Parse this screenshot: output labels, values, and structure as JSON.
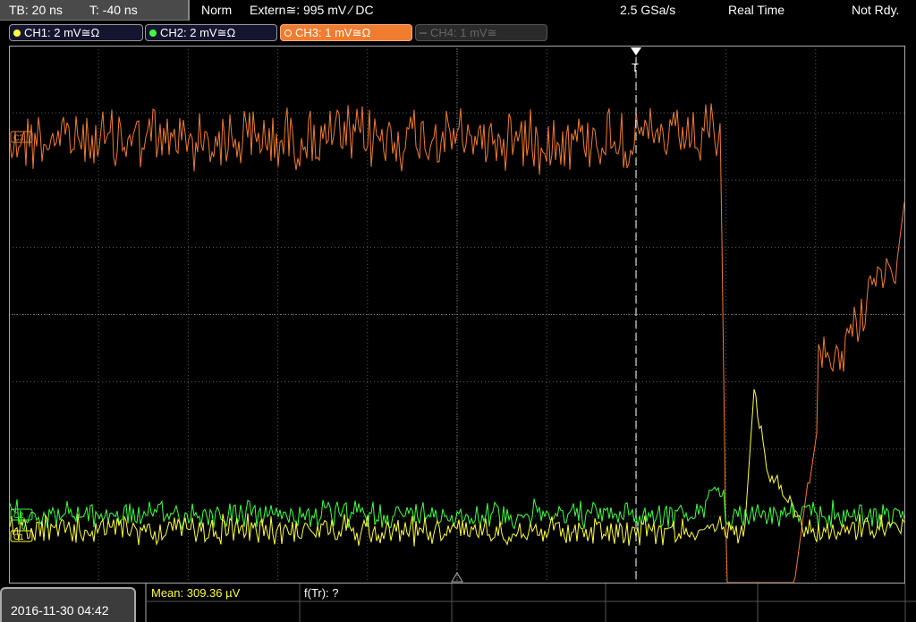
{
  "topbar": {
    "timebase": "TB: 20 ns",
    "trigger_time": "T: -40 ns",
    "trigger_mode": "Norm",
    "trigger_source": "Extern≅: 995 mV ⁄ DC",
    "sample_rate": "2.5 GSa/s",
    "acq_mode": "Real Time",
    "status": "Not Rdy."
  },
  "channels": [
    {
      "label": "CH1: 2 mV≅Ω",
      "color": "#ffff40",
      "state": "on"
    },
    {
      "label": "CH2: 2 mV≅Ω",
      "color": "#40ff40",
      "state": "on"
    },
    {
      "label": "CH3: 1 mV≅Ω",
      "color": "#f07c30",
      "state": "active"
    },
    {
      "label": "CH4: 1 mV≅",
      "color": "#666666",
      "state": "off"
    }
  ],
  "markers": {
    "ch1": "C1",
    "ch2": "C2",
    "ch3": "C3",
    "trigger": "T"
  },
  "measurements": {
    "mean": "Mean: 309.36 µV",
    "freq": "f(Tr): ?"
  },
  "datetime": "2016-11-30 04:42",
  "colors": {
    "ch1": "#ffff40",
    "ch2": "#40ff40",
    "ch3": "#f07c30",
    "grid": "#5a5a5a"
  }
}
